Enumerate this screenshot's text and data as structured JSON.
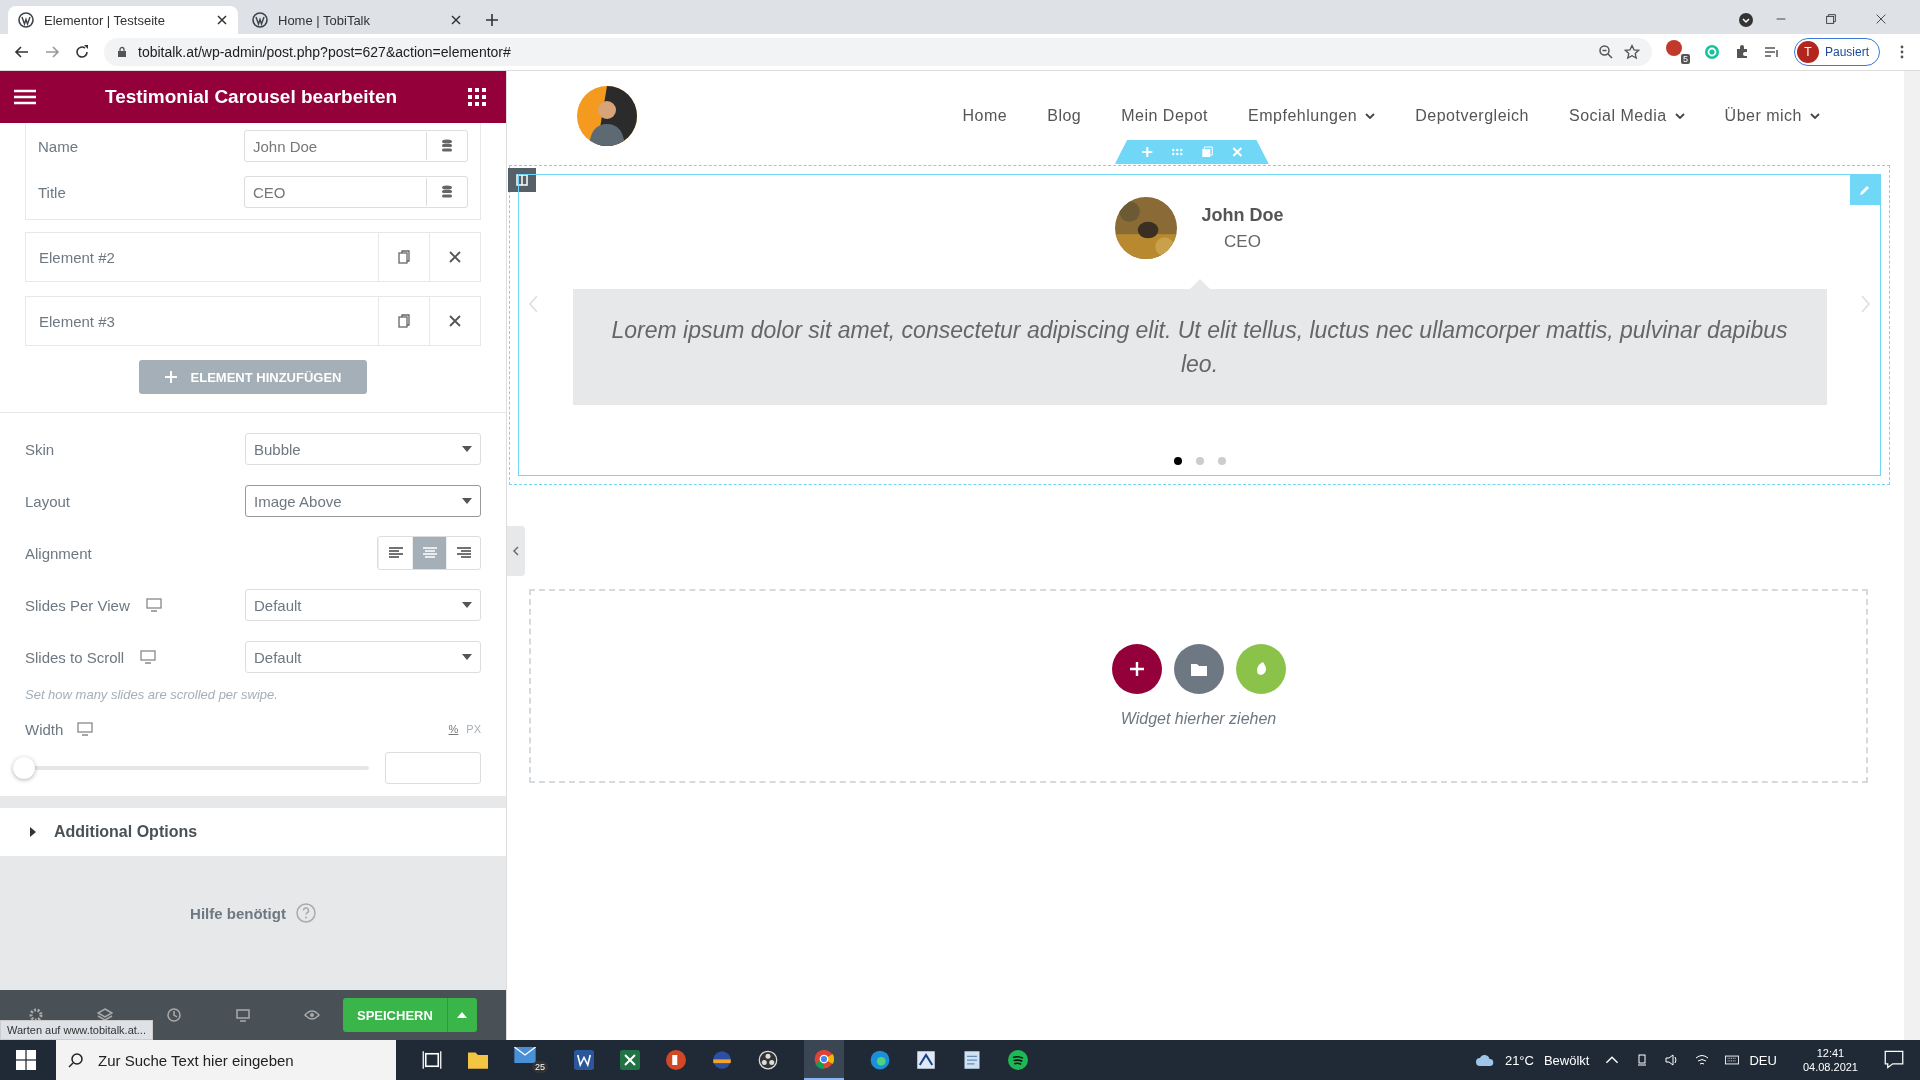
{
  "browser": {
    "tabs": [
      {
        "title": "Elementor | Testseite",
        "selected": true
      },
      {
        "title": "Home | TobiTalk",
        "selected": false
      }
    ],
    "url": "tobitalk.at/wp-admin/post.php?post=627&action=elementor#",
    "extension_badge": "5",
    "profile": {
      "initial": "T",
      "label": "Pausiert"
    }
  },
  "panel": {
    "title": "Testimonial Carousel bearbeiten",
    "repeater_fields": [
      {
        "label": "Name",
        "value": "John Doe"
      },
      {
        "label": "Title",
        "value": "CEO"
      }
    ],
    "repeater_items": [
      {
        "label": "Element #2"
      },
      {
        "label": "Element #3"
      }
    ],
    "add_button": "ELEMENT HINZUFÜGEN",
    "settings": [
      {
        "kind": "select",
        "label": "Skin",
        "value": "Bubble",
        "responsive": false,
        "focused": false
      },
      {
        "kind": "select",
        "label": "Layout",
        "value": "Image Above",
        "responsive": false,
        "focused": true
      },
      {
        "kind": "align",
        "label": "Alignment",
        "options": [
          {
            "kind": "left",
            "selected": false
          },
          {
            "kind": "center",
            "selected": true
          },
          {
            "kind": "right",
            "selected": false
          }
        ]
      },
      {
        "kind": "select",
        "label": "Slides Per View",
        "value": "Default",
        "responsive": true,
        "focused": false
      },
      {
        "kind": "select",
        "label": "Slides to Scroll",
        "value": "Default",
        "responsive": true,
        "focused": false
      }
    ],
    "hint": "Set how many slides are scrolled per swipe.",
    "width": {
      "label": "Width",
      "units": [
        {
          "label": "%",
          "selected": true
        },
        {
          "label": "PX",
          "selected": false
        }
      ],
      "level": 0
    },
    "additional_options": {
      "label": "Additional Options",
      "expanded": false
    },
    "help": "Hilfe benötigt",
    "save_button": "SPEICHERN",
    "status_text": "Warten auf www.tobitalk.at..."
  },
  "preview": {
    "nav": [
      {
        "label": "Home",
        "dropdown": false
      },
      {
        "label": "Blog",
        "dropdown": false
      },
      {
        "label": "Mein Depot",
        "dropdown": false
      },
      {
        "label": "Empfehlungen",
        "dropdown": true
      },
      {
        "label": "Depotvergleich",
        "dropdown": false
      },
      {
        "label": "Social Media",
        "dropdown": true
      },
      {
        "label": "Über mich",
        "dropdown": true
      }
    ],
    "testimonial": {
      "name": "John Doe",
      "title": "CEO",
      "content": "Lorem ipsum dolor sit amet, consectetur adipiscing elit. Ut elit tellus, luctus nec ullamcorper mattis, pulvinar dapibus leo."
    },
    "dots": [
      {
        "selected": true
      },
      {
        "selected": false
      },
      {
        "selected": false
      }
    ],
    "drop_text": "Widget hierher ziehen"
  },
  "taskbar": {
    "search_placeholder": "Zur Suche Text hier eingeben",
    "mail_badge": "25",
    "temperature": "21°C",
    "weather": "Bewölkt",
    "language": "DEU",
    "time": "12:41",
    "date": "04.08.2021"
  }
}
